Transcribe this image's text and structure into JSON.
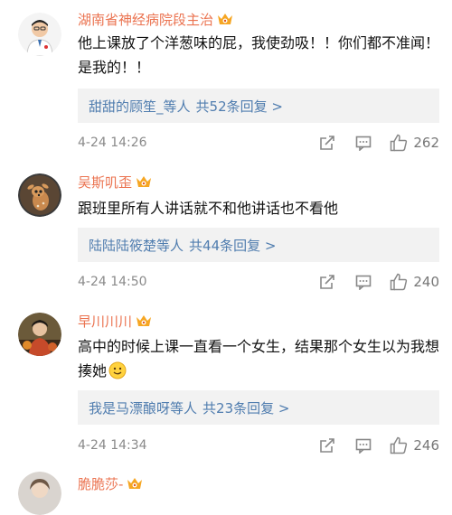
{
  "comments": [
    {
      "username": "湖南省神经病院段主治",
      "text": "他上课放了个洋葱味的屁，我使劲吸！！你们都不准闻！是我的！！",
      "reply_names": "甜甜的顾笙_",
      "reply_mid": "等人",
      "reply_count": "共52条回复 >",
      "timestamp": "4-24 14:26",
      "likes": "262",
      "avatar_icon": "doctor-avatar"
    },
    {
      "username": "吴斯叽歪",
      "text": "跟班里所有人讲话就不和他讲话也不看他",
      "reply_names": "陆陆陆筱楚",
      "reply_mid": "等人",
      "reply_count": "共44条回复 >",
      "timestamp": "4-24 14:50",
      "likes": "240",
      "avatar_icon": "deer-avatar"
    },
    {
      "username": "早川川川",
      "text": "高中的时候上课一直看一个女生，结果那个女生以为我想揍她",
      "reply_names": "我是马漂酿呀",
      "reply_mid": "等人",
      "reply_count": "共23条回复 >",
      "timestamp": "4-24 14:34",
      "likes": "246",
      "avatar_icon": "person-avatar"
    },
    {
      "username": "脆脆莎-",
      "avatar_icon": "person-avatar"
    }
  ],
  "colors": {
    "username": "#eb7350",
    "link": "#507daf",
    "reply_bg": "#f2f2f2",
    "meta": "#8a8a8a"
  }
}
